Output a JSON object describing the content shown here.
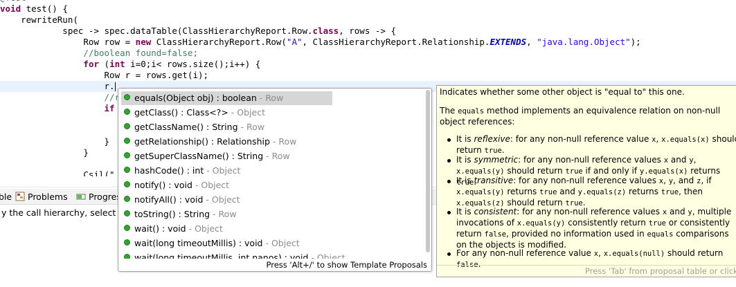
{
  "editor": {
    "lines": [
      {
        "type": "annot",
        "text": "@Test"
      },
      {
        "type": "plain",
        "parts": [
          {
            "k": "kw",
            "t": "void"
          },
          {
            "k": "p",
            "t": " test() {"
          }
        ]
      },
      {
        "type": "plain",
        "parts": [
          {
            "k": "p",
            "t": "    rewriteRun("
          }
        ]
      },
      {
        "type": "plain",
        "parts": [
          {
            "k": "p",
            "t": "            spec -> spec.dataTable(ClassHierarchyReport.Row."
          },
          {
            "k": "kw",
            "t": "class"
          },
          {
            "k": "p",
            "t": ", rows -> {"
          }
        ]
      },
      {
        "type": "plain",
        "parts": [
          {
            "k": "p",
            "t": "                Row row = "
          },
          {
            "k": "kw",
            "t": "new"
          },
          {
            "k": "p",
            "t": " ClassHierarchyReport.Row("
          },
          {
            "k": "str",
            "t": "\"A\""
          },
          {
            "k": "p",
            "t": ", ClassHierarchyReport.Relationship."
          },
          {
            "k": "const",
            "t": "EXTENDS"
          },
          {
            "k": "p",
            "t": ", "
          },
          {
            "k": "str",
            "t": "\"java.lang.Object\""
          },
          {
            "k": "p",
            "t": ");"
          }
        ]
      },
      {
        "type": "plain",
        "parts": [
          {
            "k": "cmt",
            "t": "                //boolean found=false;"
          }
        ]
      },
      {
        "type": "plain",
        "parts": [
          {
            "k": "p",
            "t": "                "
          },
          {
            "k": "kw",
            "t": "for"
          },
          {
            "k": "p",
            "t": " ("
          },
          {
            "k": "kw",
            "t": "int"
          },
          {
            "k": "p",
            "t": " i=0;i< rows.size();i++) {"
          }
        ]
      },
      {
        "type": "plain",
        "parts": [
          {
            "k": "p",
            "t": "                    Row r = rows.get(i);"
          }
        ]
      },
      {
        "type": "current",
        "parts": [
          {
            "k": "p",
            "t": "                    r."
          }
        ]
      },
      {
        "type": "plain",
        "parts": [
          {
            "k": "cmt",
            "t": "                    //r"
          }
        ]
      },
      {
        "type": "plain",
        "parts": [
          {
            "k": "p",
            "t": "                    "
          },
          {
            "k": "kw",
            "t": "if"
          }
        ]
      },
      {
        "type": "plain",
        "parts": [
          {
            "k": "p",
            "t": ""
          }
        ]
      },
      {
        "type": "plain",
        "parts": [
          {
            "k": "p",
            "t": ""
          }
        ]
      },
      {
        "type": "plain",
        "parts": [
          {
            "k": "p",
            "t": "                    }"
          }
        ]
      },
      {
        "type": "plain",
        "parts": [
          {
            "k": "p",
            "t": "                }"
          }
        ]
      },
      {
        "type": "plain",
        "parts": [
          {
            "k": "p",
            "t": ""
          }
        ]
      },
      {
        "type": "plain",
        "parts": [
          {
            "k": "p",
            "t": "                Csil(\""
          }
        ]
      }
    ]
  },
  "views": {
    "tabs": [
      {
        "name": "tab-console",
        "label": "ble"
      },
      {
        "name": "tab-problems",
        "label": "Problems"
      },
      {
        "name": "tab-progress",
        "label": "Progres"
      }
    ],
    "message": "y the call hierarchy, select one"
  },
  "proposals": {
    "items": [
      {
        "label": "equals(Object obj) : boolean",
        "owner": "Row",
        "selected": true
      },
      {
        "label": "getClass() : Class<?>",
        "owner": "Object",
        "selected": false
      },
      {
        "label": "getClassName() : String",
        "owner": "Row",
        "selected": false
      },
      {
        "label": "getRelationship() : Relationship",
        "owner": "Row",
        "selected": false
      },
      {
        "label": "getSuperClassName() : String",
        "owner": "Row",
        "selected": false
      },
      {
        "label": "hashCode() : int",
        "owner": "Object",
        "selected": false
      },
      {
        "label": "notify() : void",
        "owner": "Object",
        "selected": false
      },
      {
        "label": "notifyAll() : void",
        "owner": "Object",
        "selected": false
      },
      {
        "label": "toString() : String",
        "owner": "Row",
        "selected": false
      },
      {
        "label": "wait() : void",
        "owner": "Object",
        "selected": false
      },
      {
        "label": "wait(long timeoutMillis) : void",
        "owner": "Object",
        "selected": false
      },
      {
        "label": "wait(long timeoutMillis, int nanos) : void",
        "owner": "Object",
        "selected": false
      }
    ],
    "footer": "Press 'Alt+/' to show Template Proposals"
  },
  "javadoc": {
    "title": "Indicates whether some other object is \"equal to\" this one.",
    "intro_a": "The ",
    "intro_code": "equals",
    "intro_b": " method implements an equivalence relation on non-null object references:",
    "items": [
      [
        {
          "t": "It is "
        },
        {
          "i": "reflexive"
        },
        {
          "t": ": for any non-null reference value "
        },
        {
          "c": "x"
        },
        {
          "t": ", "
        },
        {
          "c": "x.equals(x)"
        },
        {
          "t": " should return "
        },
        {
          "c": "true"
        },
        {
          "t": "."
        }
      ],
      [
        {
          "t": "It is "
        },
        {
          "i": "symmetric"
        },
        {
          "t": ": for any non-null reference values "
        },
        {
          "c": "x"
        },
        {
          "t": " and "
        },
        {
          "c": "y"
        },
        {
          "t": ", "
        },
        {
          "c": "x.equals(y)"
        },
        {
          "t": " should return "
        },
        {
          "c": "true"
        },
        {
          "t": " if and only if "
        },
        {
          "c": "y.equals(x)"
        },
        {
          "t": " returns "
        },
        {
          "c": "true"
        },
        {
          "t": "."
        }
      ],
      [
        {
          "t": "It is "
        },
        {
          "i": "transitive"
        },
        {
          "t": ": for any non-null reference values "
        },
        {
          "c": "x"
        },
        {
          "t": ", "
        },
        {
          "c": "y"
        },
        {
          "t": ", and "
        },
        {
          "c": "z"
        },
        {
          "t": ", if "
        },
        {
          "c": "x.equals(y)"
        },
        {
          "t": " returns "
        },
        {
          "c": "true"
        },
        {
          "t": " and "
        },
        {
          "c": "y.equals(z)"
        },
        {
          "t": " returns "
        },
        {
          "c": "true"
        },
        {
          "t": ", then "
        },
        {
          "c": "x.equals(z)"
        },
        {
          "t": " should return "
        },
        {
          "c": "true"
        },
        {
          "t": "."
        }
      ],
      [
        {
          "t": "It is "
        },
        {
          "i": "consistent"
        },
        {
          "t": ": for any non-null reference values "
        },
        {
          "c": "x"
        },
        {
          "t": " and "
        },
        {
          "c": "y"
        },
        {
          "t": ", multiple invocations of "
        },
        {
          "c": "x.equals(y)"
        },
        {
          "t": " consistently return "
        },
        {
          "c": "true"
        },
        {
          "t": " or consistently return "
        },
        {
          "c": "false"
        },
        {
          "t": ", provided no information used in "
        },
        {
          "c": "equals"
        },
        {
          "t": " comparisons on the objects is modified."
        }
      ],
      [
        {
          "t": "For any non-null reference value "
        },
        {
          "c": "x"
        },
        {
          "t": ", "
        },
        {
          "c": "x.equals(null)"
        },
        {
          "t": " should return "
        },
        {
          "c": "false"
        },
        {
          "t": "."
        }
      ]
    ],
    "status": "Press 'Tab' from proposal table or click for focus"
  },
  "colors": {
    "keyword": "#7f0055",
    "string": "#2a00ff",
    "comment": "#3f7f5f",
    "constant": "#0000c0",
    "current_line": "#e8f2fe",
    "javadoc_bg": "#ffffe1",
    "method_dot": "#2fa62f"
  }
}
